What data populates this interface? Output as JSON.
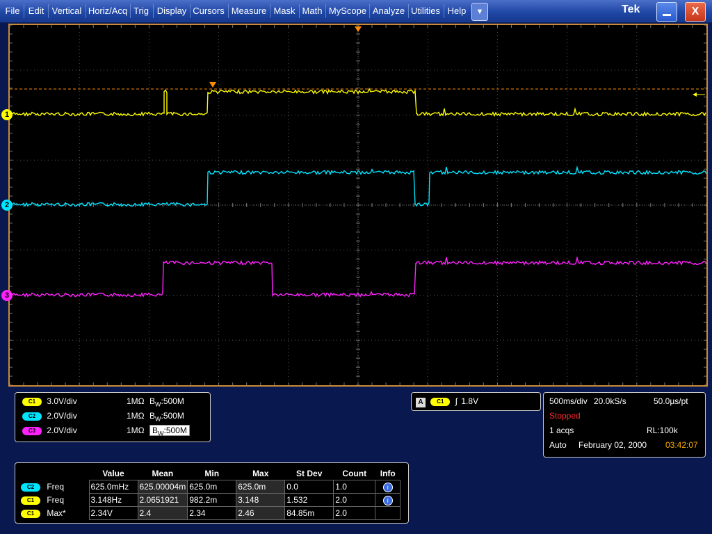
{
  "menu": [
    "File",
    "Edit",
    "Vertical",
    "Horiz/Acq",
    "Trig",
    "Display",
    "Cursors",
    "Measure",
    "Mask",
    "Math",
    "MyScope",
    "Analyze",
    "Utilities",
    "Help"
  ],
  "menu_dropdown": "▼",
  "brand": "Tek",
  "window": {
    "minimize": "_",
    "close": "X"
  },
  "colors": {
    "ch1": "#ffff00",
    "ch2": "#00e5ff",
    "ch3": "#ff22ff",
    "trigger": "#ff8c00"
  },
  "channel_markers": [
    "1",
    "2",
    "3"
  ],
  "channels": [
    {
      "badge": "C1",
      "scale": "3.0V/div",
      "impedance": "1MΩ",
      "bw_prefix": "B",
      "bw_sub": "W",
      "bw_value": ":500M"
    },
    {
      "badge": "C2",
      "scale": "2.0V/div",
      "impedance": "1MΩ",
      "bw_prefix": "B",
      "bw_sub": "W",
      "bw_value": ":500M"
    },
    {
      "badge": "C3",
      "scale": "2.0V/div",
      "impedance": "1MΩ",
      "bw_prefix": "B",
      "bw_sub": "W",
      "bw_value": ":500M"
    }
  ],
  "trigger": {
    "mode": "A",
    "source": "C1",
    "slope": "∫",
    "level": "1.8V"
  },
  "acquisition": {
    "timebase": "500ms/div",
    "sample_rate": "20.0kS/s",
    "resolution": "50.0µs/pt",
    "state": "Stopped",
    "acqs": "1 acqs",
    "record_length": "RL:100k",
    "mode": "Auto",
    "date": "February 02, 2000",
    "time": "03:42:07"
  },
  "measurements": {
    "headers": [
      "Value",
      "Mean",
      "Min",
      "Max",
      "St Dev",
      "Count",
      "Info"
    ],
    "rows": [
      {
        "badge": "C2",
        "name": "Freq",
        "value": "625.0mHz",
        "mean": "625.00004m",
        "min": "625.0m",
        "max": "625.0m",
        "stdev": "0.0",
        "count": "1.0",
        "info": "i"
      },
      {
        "badge": "C1",
        "name": "Freq",
        "value": "3.148Hz",
        "mean": "2.0651921",
        "min": "982.2m",
        "max": "3.148",
        "stdev": "1.532",
        "count": "2.0",
        "info": "i"
      },
      {
        "badge": "C1",
        "name": "Max*",
        "value": "2.34V",
        "mean": "2.4",
        "min": "2.34",
        "max": "2.46",
        "stdev": "84.85m",
        "count": "2.0",
        "info": ""
      }
    ]
  }
}
